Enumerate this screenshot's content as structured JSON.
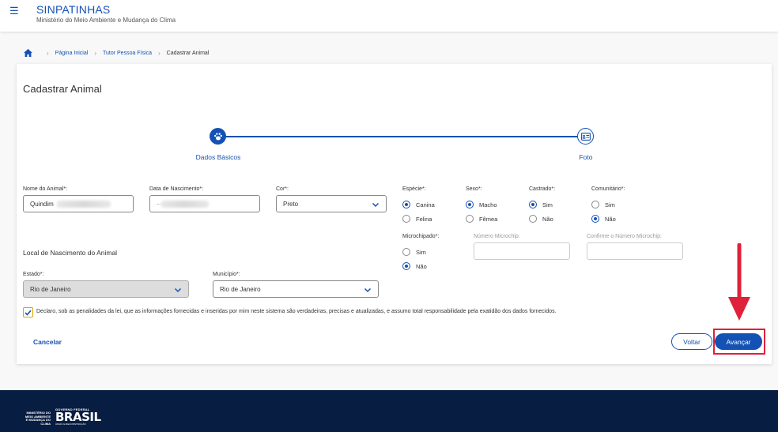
{
  "header": {
    "menu_icon": "hamburger-icon",
    "title": "SINPATINHAS",
    "subtitle": "Ministério do Meio Ambiente e Mudança do Clima"
  },
  "breadcrumb": {
    "home_icon": "home-icon",
    "items": [
      "Página Inicial",
      "Tutor Pessoa Física",
      "Cadastrar Animal"
    ]
  },
  "form": {
    "title": "Cadastrar Animal",
    "steps": [
      {
        "label": "Dados Básicos",
        "icon": "paw-icon",
        "active": true
      },
      {
        "label": "Foto",
        "icon": "id-card-icon",
        "active": false
      }
    ],
    "nome": {
      "label": "Nome do Animal*:",
      "value": "Quindim"
    },
    "nascimento": {
      "label": "Data de Nascimento*:",
      "value": "..."
    },
    "cor": {
      "label": "Cor*:",
      "value": "Preto"
    },
    "especie": {
      "label": "Espécie*:",
      "options": [
        "Canina",
        "Felina"
      ],
      "selected": "Canina"
    },
    "sexo": {
      "label": "Sexo*:",
      "options": [
        "Macho",
        "Fêmea"
      ],
      "selected": "Macho"
    },
    "castrado": {
      "label": "Castrado*:",
      "options": [
        "Sim",
        "Não"
      ],
      "selected": "Sim"
    },
    "comunitario": {
      "label": "Comunitário*:",
      "options": [
        "Sim",
        "Não"
      ],
      "selected": "Não"
    },
    "microchipado": {
      "label": "Microchipado*:",
      "options": [
        "Sim",
        "Não"
      ],
      "selected": "Não"
    },
    "numero_microchip": {
      "label": "Número Microchip:"
    },
    "confirme_microchip": {
      "label": "Confirme o Número Microchip:"
    },
    "local_title": "Local de Nascimento do Animal",
    "estado": {
      "label": "Estado*:",
      "value": "Rio de Janeiro"
    },
    "municipio": {
      "label": "Município*:",
      "value": "Rio de Janeiro"
    },
    "declaracao": "Declaro, sob as penalidades da lei, que as informações fornecidas e inseridas por mim neste sistema são verdadeiras, precisas e atualizadas, e assumo total responsabilidade pela exatidão dos dados fornecidos.",
    "declaracao_checked": true
  },
  "actions": {
    "cancel": "Cancelar",
    "back": "Voltar",
    "next": "Avançar"
  },
  "annotation": {
    "color": "#e0213a"
  },
  "footer": {
    "ministry": "MINISTÉRIO DO MEIO AMBIENTE E MUDANÇA DO CLIMA",
    "gov": "GOVERNO FEDERAL",
    "brasil": "BRASIL",
    "slogan": "UNIÃO E RECONSTRUÇÃO"
  },
  "colors": {
    "primary": "#1351b4",
    "footer_bg": "#071d41",
    "checkbox_border": "#e0a100"
  }
}
